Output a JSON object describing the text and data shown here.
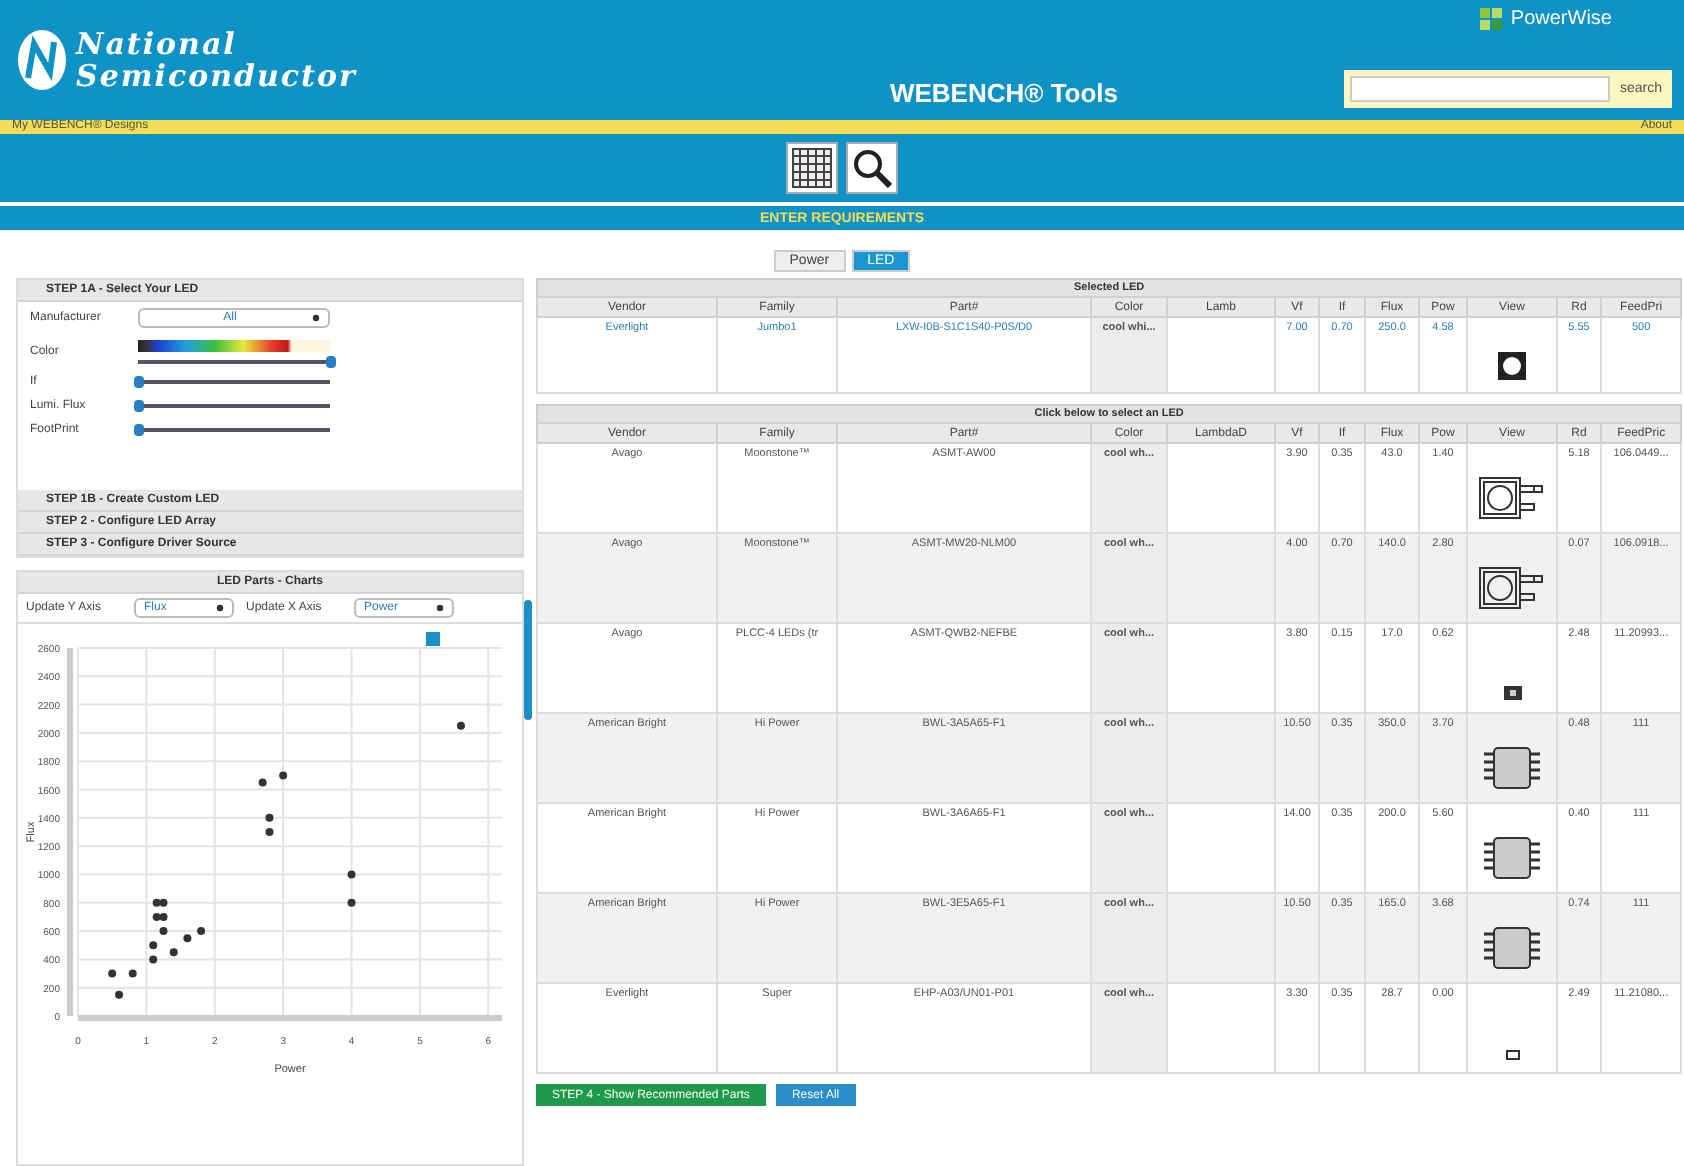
{
  "header": {
    "brand": "National",
    "brand_line2": "Semiconductor",
    "title": "WEBENCH® Tools",
    "partner_logo": "PowerWise",
    "search_button": "search"
  },
  "nav_bar": {
    "left": "My WEBENCH® Designs",
    "right": "About"
  },
  "requirements_bar": "ENTER REQUIREMENTS",
  "tabs": [
    {
      "label": "Power",
      "selected": false
    },
    {
      "label": "LED",
      "selected": true
    }
  ],
  "left_panel": {
    "step1a": "STEP 1A - Select Your LED",
    "manufacturer": {
      "label": "Manufacturer",
      "value": "All"
    },
    "filters": [
      {
        "label": "Color",
        "kind": "spectrum",
        "level": 1
      },
      {
        "label": "If",
        "kind": "plain",
        "level": 0
      },
      {
        "label": "Lumi. Flux",
        "kind": "plain",
        "level": 0
      },
      {
        "label": "FootPrint",
        "kind": "plain",
        "level": 0
      }
    ],
    "steps": [
      "STEP 1B - Create Custom LED",
      "STEP 2 - Configure LED Array",
      "STEP 3 - Configure Driver Source"
    ],
    "charts_title": "LED Parts - Charts",
    "y_axis": {
      "label": "Update Y Axis",
      "value": "Flux"
    },
    "x_axis": {
      "label": "Update X Axis",
      "value": "Power"
    },
    "chart_data": {
      "type": "scatter",
      "xlabel": "Power",
      "ylabel": "Flux",
      "grid": true,
      "xlim": [
        0,
        6.2
      ],
      "ylim": [
        0,
        2600
      ],
      "xticks": [
        0,
        1,
        2,
        3,
        4,
        5,
        6
      ],
      "yticks": [
        0,
        200,
        400,
        600,
        800,
        1000,
        1200,
        1400,
        1600,
        1800,
        2000,
        2200,
        2400,
        2600
      ],
      "series": [
        {
          "color": "#333333",
          "x": [
            0.5,
            0.6,
            0.8,
            1.1,
            1.1,
            1.15,
            1.25,
            1.15,
            1.25,
            1.25,
            1.4,
            1.6,
            1.8,
            2.7,
            3.0,
            2.8,
            2.8,
            4.0,
            4.0,
            5.6
          ],
          "values": [
            300,
            150,
            300,
            400,
            500,
            800,
            800,
            700,
            700,
            600,
            450,
            550,
            600,
            1650,
            1700,
            1400,
            1300,
            1000,
            800,
            2050
          ]
        }
      ]
    }
  },
  "selected_table": {
    "title": "Selected LED",
    "columns": [
      "Vendor",
      "Family",
      "Part#",
      "Color",
      "Lamb",
      "Vf",
      "If",
      "Flux",
      "Pow",
      "View",
      "Rd",
      "FeedPri"
    ],
    "rows": [
      {
        "cells": [
          "Everlight",
          "Jumbo1",
          "LXW-I0B-S1C1S40-P0S/D0",
          "cool whi...",
          "",
          "7.00",
          "0.70",
          "250.0",
          "4.58",
          "",
          "5.55",
          "500"
        ],
        "kind": "square"
      }
    ]
  },
  "parts_table": {
    "title": "Click below to select an LED",
    "columns": [
      "Vendor",
      "Family",
      "Part#",
      "Color",
      "LambdaD",
      "Vf",
      "If",
      "Flux",
      "Pow",
      "View",
      "Rd",
      "FeedPric"
    ],
    "rows": [
      {
        "cells": [
          "Avago",
          "Moonstone™",
          "ASMT-AW00",
          "cool wh...",
          "",
          "3.90",
          "0.35",
          "43.0",
          "1.40",
          "",
          "5.18",
          "106.0449..."
        ],
        "kind": "moonstone"
      },
      {
        "cells": [
          "Avago",
          "Moonstone™",
          "ASMT-MW20-NLM00",
          "cool wh...",
          "",
          "4.00",
          "0.70",
          "140.0",
          "2.80",
          "",
          "0.07",
          "106.0918..."
        ],
        "kind": "moonstone"
      },
      {
        "cells": [
          "Avago",
          "PLCC-4 LEDs (tr",
          "ASMT-QWB2-NEFBE",
          "cool wh...",
          "",
          "3.80",
          "0.15",
          "17.0",
          "0.62",
          "",
          "2.48",
          "11.20993..."
        ],
        "kind": "chip"
      },
      {
        "cells": [
          "American Bright",
          "Hi Power",
          "BWL-3A5A65-F1",
          "cool wh...",
          "",
          "10.50",
          "0.35",
          "350.0",
          "3.70",
          "",
          "0.48",
          "111"
        ],
        "kind": "soic"
      },
      {
        "cells": [
          "American Bright",
          "Hi Power",
          "BWL-3A6A65-F1",
          "cool wh...",
          "",
          "14.00",
          "0.35",
          "200.0",
          "5.60",
          "",
          "0.40",
          "111"
        ],
        "kind": "soic"
      },
      {
        "cells": [
          "American Bright",
          "Hi Power",
          "BWL-3E5A65-F1",
          "cool wh...",
          "",
          "10.50",
          "0.35",
          "165.0",
          "3.68",
          "",
          "0.74",
          "111"
        ],
        "kind": "soic"
      },
      {
        "cells": [
          "Everlight",
          "Super",
          "EHP-A03/UN01-P01",
          "cool wh...",
          "",
          "3.30",
          "0.35",
          "28.7",
          "0.00",
          "",
          "2.49",
          "11.21080..."
        ],
        "kind": "tiny"
      }
    ]
  },
  "buttons": [
    {
      "label": "STEP 4 - Show Recommended Parts",
      "kind": "primary"
    },
    {
      "label": "Reset All",
      "kind": "secondary"
    }
  ]
}
